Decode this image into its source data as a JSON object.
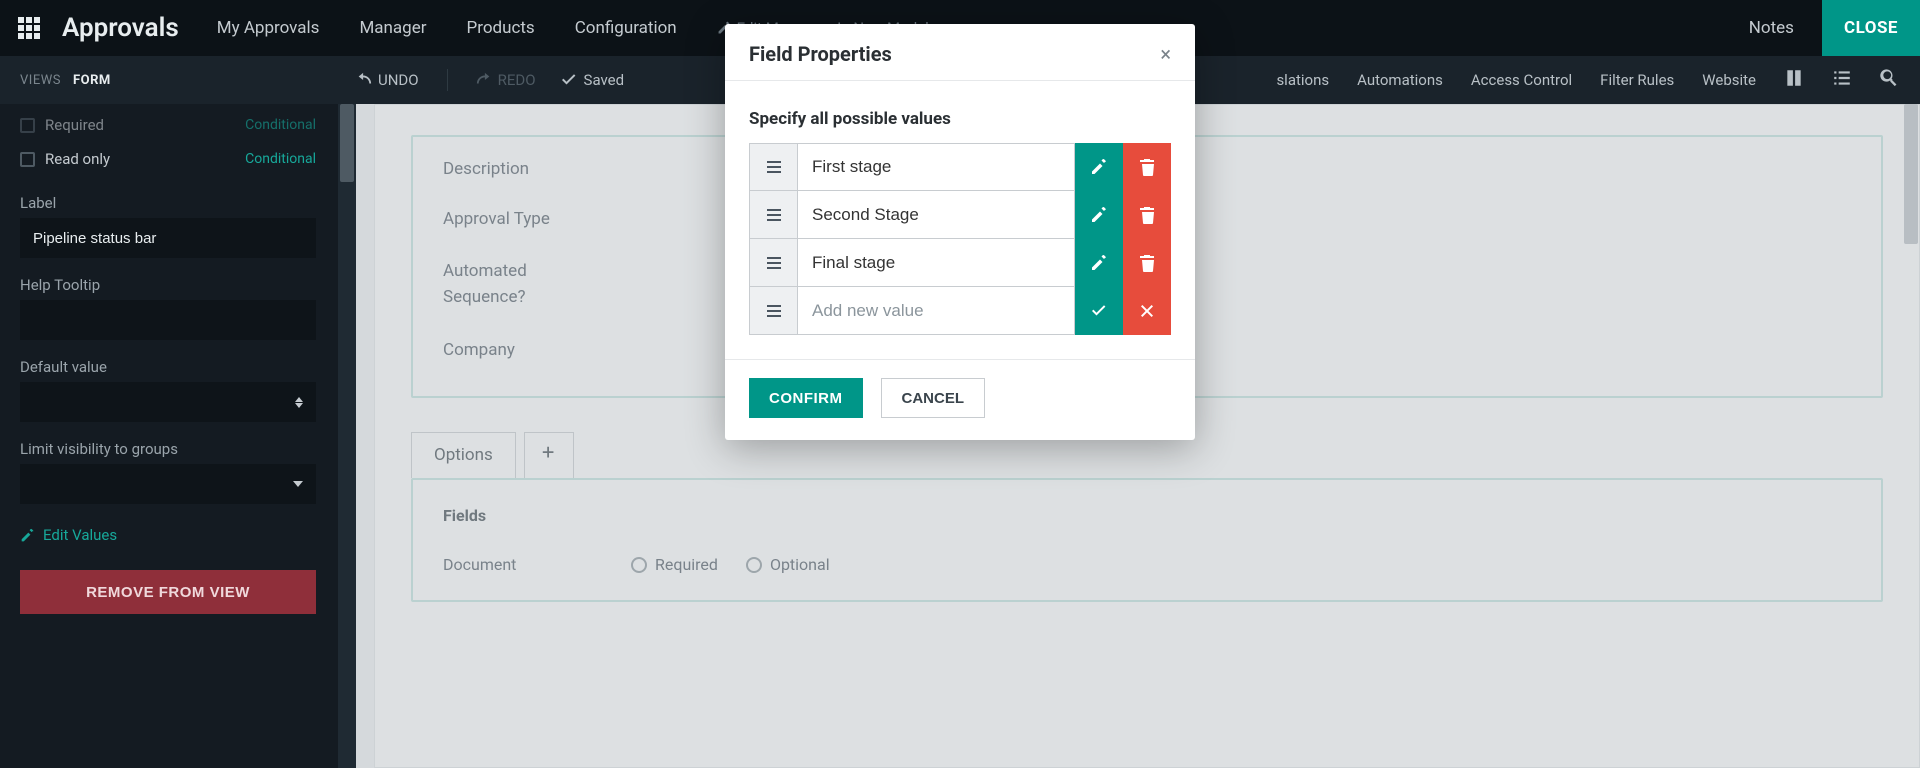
{
  "topbar": {
    "brand": "Approvals",
    "menu": [
      "My Approvals",
      "Manager",
      "Products",
      "Configuration"
    ],
    "dev_links": {
      "edit_menu": "Edit Menu",
      "new_model": "New Model"
    },
    "notes": "Notes",
    "close": "CLOSE"
  },
  "secbar": {
    "views_label": "VIEWS",
    "views_active": "FORM",
    "undo": "UNDO",
    "redo": "REDO",
    "saved": "Saved",
    "right_links": [
      "slations",
      "Automations",
      "Access Control",
      "Filter Rules",
      "Website"
    ]
  },
  "sidebar": {
    "rows": [
      {
        "label": "Required",
        "conditional": "Conditional"
      },
      {
        "label": "Read only",
        "conditional": "Conditional"
      }
    ],
    "label_label": "Label",
    "label_value": "Pipeline status bar",
    "help_label": "Help Tooltip",
    "help_value": "",
    "default_label": "Default value",
    "groups_label": "Limit visibility to groups",
    "edit_values": "Edit Values",
    "remove": "REMOVE FROM VIEW"
  },
  "canvas": {
    "labels": [
      "Description",
      "Approval Type",
      "Automated Sequence?",
      "Company"
    ],
    "tab_options": "Options",
    "fields_heading": "Fields",
    "row_label": "Document",
    "radio1": "Required",
    "radio2": "Optional"
  },
  "modal": {
    "title": "Field Properties",
    "subtitle": "Specify all possible values",
    "values": [
      "First stage",
      "Second Stage",
      "Final stage"
    ],
    "add_placeholder": "Add new value",
    "confirm": "CONFIRM",
    "cancel": "CANCEL"
  }
}
